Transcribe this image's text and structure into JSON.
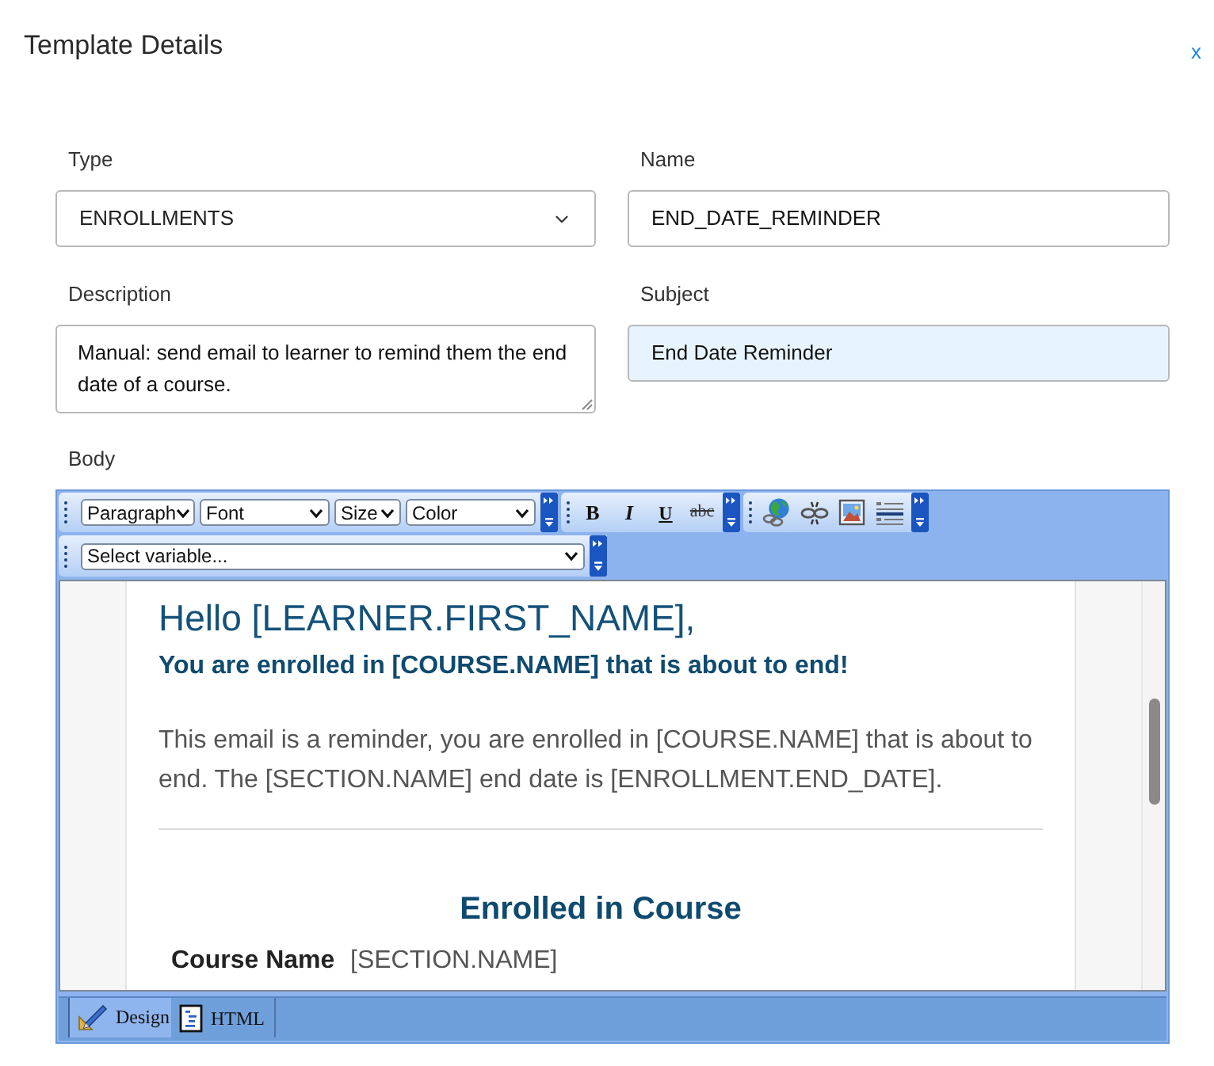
{
  "dialog": {
    "title": "Template Details",
    "close_label": "x"
  },
  "fields": [
    {
      "kind": "select",
      "label": "Type",
      "value": "ENROLLMENTS",
      "highlighted": false
    },
    {
      "kind": "text",
      "label": "Name",
      "value": "END_DATE_REMINDER",
      "highlighted": false
    },
    {
      "kind": "textarea",
      "label": "Description",
      "value": "Manual: send email to learner to remind them the end date of a course.",
      "highlighted": false
    },
    {
      "kind": "text",
      "label": "Subject",
      "value": "End Date Reminder",
      "highlighted": true
    }
  ],
  "body": {
    "label": "Body",
    "toolbars": [
      {
        "groups": [
          {
            "items": [
              {
                "kind": "dropdown",
                "label": "Paragraph"
              },
              {
                "kind": "dropdown",
                "label": "Font"
              },
              {
                "kind": "dropdown",
                "label": "Size"
              },
              {
                "kind": "dropdown",
                "label": "Color"
              }
            ]
          },
          {
            "items": [
              {
                "kind": "bold",
                "label": "B"
              },
              {
                "kind": "italic",
                "label": "I"
              },
              {
                "kind": "underline",
                "label": "U"
              },
              {
                "kind": "strike",
                "label": "abc"
              }
            ]
          },
          {
            "items": [
              {
                "kind": "link"
              },
              {
                "kind": "unlink"
              },
              {
                "kind": "image"
              },
              {
                "kind": "rule"
              }
            ]
          }
        ]
      },
      {
        "groups": [
          {
            "items": [
              {
                "kind": "dropdown",
                "label": "Select variable..."
              }
            ]
          }
        ]
      }
    ],
    "content": [
      {
        "kind": "greeting",
        "text": "Hello [LEARNER.FIRST_NAME],"
      },
      {
        "kind": "subheading",
        "text": "You are enrolled in [COURSE.NAME] that is about to end!"
      },
      {
        "kind": "paragraph",
        "text": "This email is a reminder, you are enrolled in [COURSE.NAME] that is about to end. The [SECTION.NAME] end date is [ENROLLMENT.END_DATE]."
      },
      {
        "kind": "divider"
      },
      {
        "kind": "heading",
        "text": "Enrolled in Course"
      },
      {
        "kind": "detail",
        "label": "Course Name",
        "value": "[SECTION.NAME]"
      }
    ],
    "mode_tabs": [
      {
        "kind": "design",
        "label": "Design",
        "selected": true
      },
      {
        "kind": "html",
        "label": "HTML",
        "selected": false
      }
    ]
  }
}
